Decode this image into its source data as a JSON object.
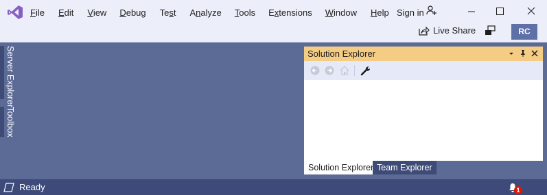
{
  "menu": {
    "items": [
      {
        "label": "File",
        "accel": "F"
      },
      {
        "label": "Edit",
        "accel": "E"
      },
      {
        "label": "View",
        "accel": "V"
      },
      {
        "label": "Debug",
        "accel": "D"
      },
      {
        "label": "Test",
        "accel": "s"
      },
      {
        "label": "Analyze",
        "accel": "n"
      },
      {
        "label": "Tools",
        "accel": "T"
      },
      {
        "label": "Extensions",
        "accel": "x"
      },
      {
        "label": "Window",
        "accel": "W"
      },
      {
        "label": "Help",
        "accel": "H"
      }
    ]
  },
  "account": {
    "sign_in_label": "Sign in",
    "avatar_initials": "RC",
    "avatar_color": "#5f6fa8"
  },
  "toolbar": {
    "live_share_label": "Live Share"
  },
  "side_tabs": {
    "server_explorer": "Server Explorer",
    "toolbox": "Toolbox"
  },
  "solution_explorer": {
    "title": "Solution Explorer",
    "title_color": "#f5cc84",
    "toolbar_icons": [
      "back-icon",
      "forward-icon",
      "home-icon",
      "wrench-icon"
    ],
    "tabs": [
      "Solution Explorer",
      "Team Explorer"
    ]
  },
  "status": {
    "text": "Ready",
    "notification_count": "1"
  },
  "colors": {
    "accent": "#68217a",
    "workspace": "#5c6a96",
    "status_bar": "#3e4b7a",
    "badge": "#e51400"
  }
}
